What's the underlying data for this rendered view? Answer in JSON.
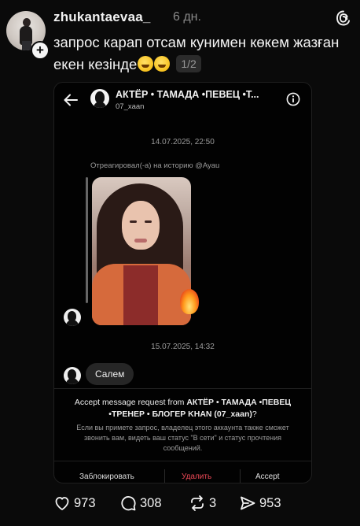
{
  "post": {
    "username": "zhukantaevaa_",
    "time": "6 дн.",
    "caption": "запрос карап отсам кунимен көкем жазған екен кезінде",
    "counter": "1/2",
    "icons": [
      "avatar",
      "plus-badge",
      "threads-icon",
      "laughing-emoji",
      "rofl-emoji"
    ]
  },
  "embed": {
    "chat_name": "АКТЁР • ТАМАДА •ПЕВЕЦ •Т...",
    "chat_handle": "07_xaan",
    "timestamp_1": "14.07.2025, 22:50",
    "reacted_text": "Отреагировал(-а) на историю @Ayau",
    "timestamp_2": "15.07.2025, 14:32",
    "message": "Салем",
    "request_title_prefix": "Accept message request from ",
    "request_title_name": "АКТЁР • ТАМАДА •ПЕВЕЦ •ТРЕНЕР • БЛОГЕР KHAN (07_xaan)",
    "request_title_suffix": "?",
    "request_text": "Если вы примете запрос, владелец этого аккаунта также сможет звонить вам, видеть ваш статус \"В сети\" и статус прочтения сообщений.",
    "buttons": {
      "block": "Заблокировать",
      "delete": "Удалить",
      "accept": "Accept"
    },
    "icons": [
      "back-arrow-icon",
      "info-icon",
      "fire-emoji"
    ]
  },
  "actions": {
    "likes": "973",
    "comments": "308",
    "reposts": "3",
    "shares": "953"
  },
  "colors": {
    "background": "#0a0a0a",
    "delete": "#ed4956",
    "muted": "#8a8a8a"
  }
}
